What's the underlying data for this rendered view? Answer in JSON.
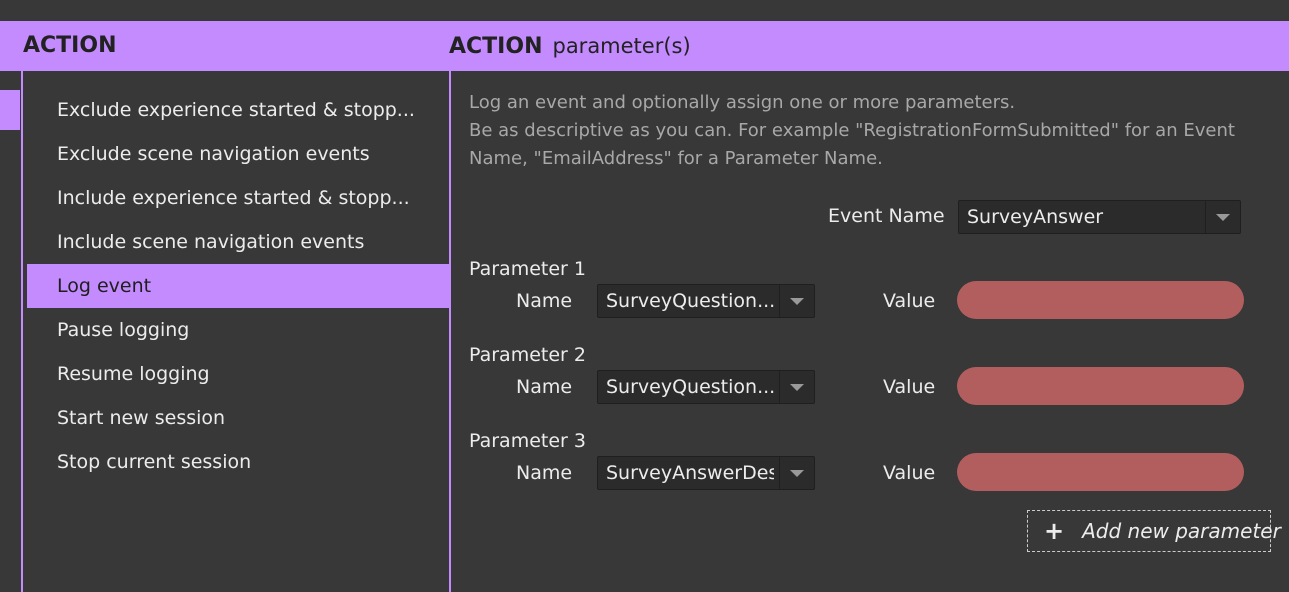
{
  "header": {
    "left_title": "ACTION",
    "right_title": "ACTION",
    "right_subtitle": "parameter(s)"
  },
  "actions": {
    "items": [
      {
        "label": "Exclude experience started & stopp..."
      },
      {
        "label": "Exclude scene navigation events"
      },
      {
        "label": "Include experience started & stopp..."
      },
      {
        "label": "Include scene navigation events"
      },
      {
        "label": "Log event"
      },
      {
        "label": "Pause logging"
      },
      {
        "label": "Resume logging"
      },
      {
        "label": "Start new session"
      },
      {
        "label": "Stop current session"
      }
    ],
    "selected": "Log event"
  },
  "description": {
    "line1": "Log an event and optionally assign one or more parameters.",
    "line2": "Be as descriptive as you can. For example \"RegistrationFormSubmitted\" for an Event",
    "line3": "Name, \"EmailAddress\" for a Parameter Name."
  },
  "event": {
    "label": "Event Name",
    "value": "SurveyAnswer"
  },
  "parameters": [
    {
      "heading": "Parameter 1",
      "name_label": "Name",
      "name_value": "SurveyQuestion...",
      "value_label": "Value",
      "value": ""
    },
    {
      "heading": "Parameter 2",
      "name_label": "Name",
      "name_value": "SurveyQuestion...",
      "value_label": "Value",
      "value": ""
    },
    {
      "heading": "Parameter 3",
      "name_label": "Name",
      "name_value": "SurveyAnswerDesc",
      "value_label": "Value",
      "value": ""
    }
  ],
  "add_parameter": {
    "icon": "plus-icon",
    "label": "Add new parameter"
  },
  "colors": {
    "accent": "#c48bff",
    "background": "#383838",
    "invalid_field": "#b35e5e"
  }
}
